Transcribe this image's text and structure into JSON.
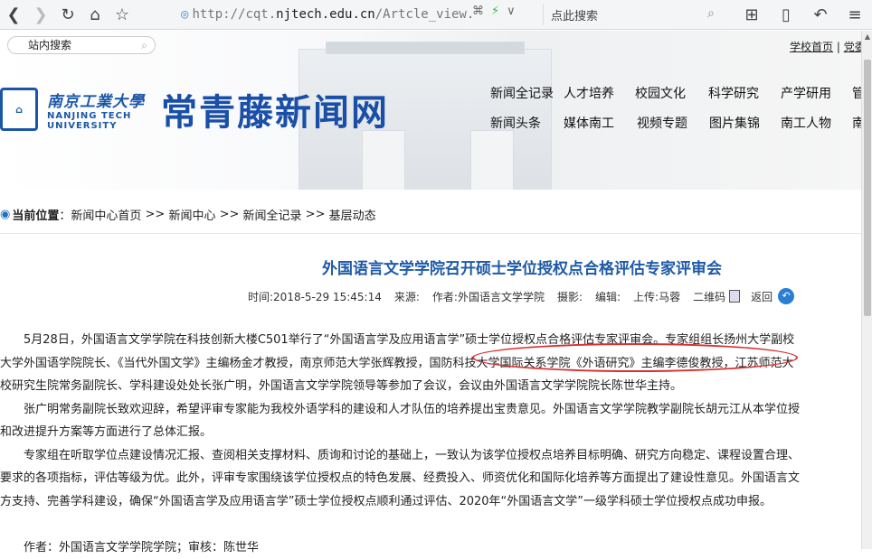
{
  "browser": {
    "url_prefix": "http://cqt.",
    "url_host": "njtech.edu.cn",
    "url_path": "/Artcle_view.",
    "search_placeholder": "点此搜索"
  },
  "header": {
    "site_search_placeholder": "站内搜索",
    "top_link_home": "学校首页",
    "top_link_sep": " | ",
    "top_link_party": "党委",
    "university_cn": "南京工業大學",
    "university_en_1": "NANJING TECH",
    "university_en_2": "UNIVERSITY",
    "site_name": "常青藤新闻网",
    "nav_row1": [
      "新闻全记录",
      "人才培养",
      "校园文化",
      "科学研究",
      "产学研用",
      "管"
    ],
    "nav_row2": [
      "新闻头条",
      "媒体南工",
      "视频专题",
      "图片集锦",
      "南工人物",
      "南"
    ]
  },
  "breadcrumb": {
    "label": "当前位置",
    "colon": "：",
    "items": [
      "新闻中心首页",
      "新闻中心",
      "新闻全记录",
      "基层动态"
    ],
    "sep": " >> "
  },
  "article": {
    "title": "外国语言文学学院召开硕士学位授权点合格评估专家评审会",
    "meta_time": "时间:2018-5-29 15:45:14",
    "meta_source": "来源:",
    "meta_author": "作者:外国语言文学学院",
    "meta_photo": "摄影:",
    "meta_editor": "编辑:",
    "meta_uploader": "上传:马蓉",
    "meta_qr": "二维码",
    "meta_back": "返回",
    "paragraphs": [
      "　　5月28日，外国语言文学学院在科技创新大楼C501举行了“外国语言学及应用语言学”硕士学位授权点合格评估专家评审会。专家组组长扬州大学副校",
      "大学外国语学院院长、《当代外国文学》主编杨金才教授，南京师范大学张辉教授，国防科技大学国际关系学院《外语研究》主编李德俊教授，江苏师范大",
      "校研究生院常务副院长、学科建设处处长张广明，外国语言文学学院领导等参加了会议，会议由外国语言文学学院院长陈世华主持。",
      "　　张广明常务副院长致欢迎辞，希望评审专家能为我校外语学科的建设和人才队伍的培养提出宝贵意见。外国语言文学学院教学副院长胡元江从本学位授",
      "和改进提升方案等方面进行了总体汇报。",
      "　　专家组在听取学位点建设情况汇报、查阅相关支撑材料、质询和讨论的基础上，一致认为该学位授权点培养目标明确、研究方向稳定、课程设置合理、",
      "要求的各项指标，评估等级为优。此外，评审专家围绕该学位授权点的特色发展、经费投入、师资优化和国际化培养等方面提出了建设性意见。外国语言文",
      "方支持、完善学科建设，确保“外国语言学及应用语言学”硕士学位授权点顺利通过评估、2020年“外国语言文学”一级学科硕士学位授权点成功申报。",
      "",
      "　　作者：外国语言文学学院学院；审核：陈世华"
    ]
  },
  "colors": {
    "accent_blue": "#1a4fa8",
    "title_blue": "#1e5aa8",
    "highlight_red": "#d93030"
  }
}
